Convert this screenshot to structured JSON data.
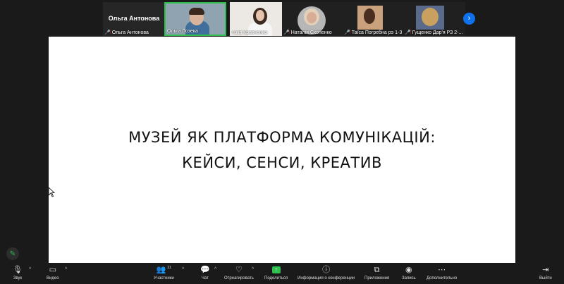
{
  "gallery": {
    "active_speaker_name": "Ольга Антонова",
    "tiles": [
      {
        "name": "Ольга Антонова",
        "muted": true
      },
      {
        "name": "Ольга Лозека",
        "muted": false
      },
      {
        "name": "Yulia Кравченко",
        "muted": false
      },
      {
        "name": "Наталія Скопенко",
        "muted": true
      },
      {
        "name": "Таїса Погребна рэ 1-3",
        "muted": true
      },
      {
        "name": "Гущенко Дар'я РЗ 2-...",
        "muted": true
      }
    ],
    "next_page_icon": "chevron-right-icon"
  },
  "slide": {
    "line1": "МУЗЕЙ ЯК ПЛАТФОРМА КОМУНІКАЦІЙ:",
    "line2": "КЕЙСИ, СЕНСИ, КРЕАТИВ"
  },
  "toolbar": {
    "audio_label": "Звук",
    "video_label": "Видео",
    "participants_label": "Участники",
    "participants_count": "21",
    "chat_label": "Чат",
    "react_label": "Отреагировать",
    "share_label": "Поделиться",
    "info_label": "Информация о конференции",
    "apps_label": "Приложения",
    "record_label": "Запись",
    "more_label": "Дополнительно",
    "leave_label": "Выйти"
  },
  "colors": {
    "background": "#1a1a1a",
    "active_border": "#2ebf4f",
    "muted_red": "#e02828",
    "accent_blue": "#0e71eb",
    "share_green": "#2ebf4f"
  }
}
